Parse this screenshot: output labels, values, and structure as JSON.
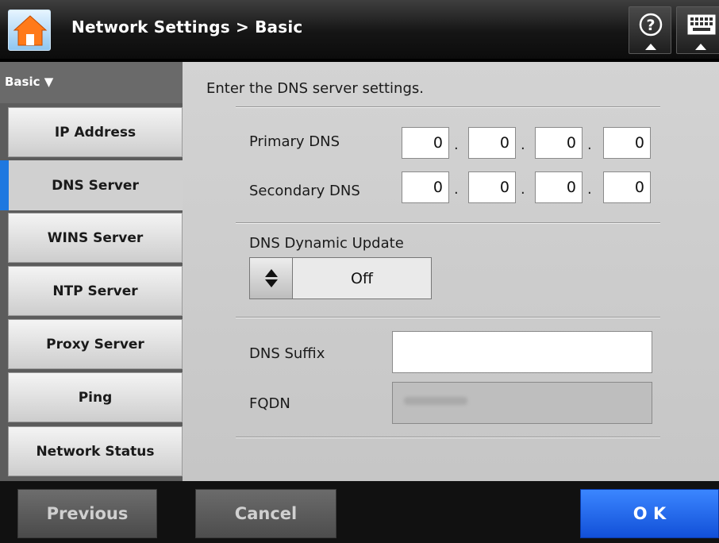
{
  "header": {
    "title": "Network Settings > Basic",
    "home_icon": "home-icon",
    "help_icon": "help-icon",
    "keyboard_icon": "keyboard-icon"
  },
  "sidebar": {
    "group_label": "Basic ▼",
    "items": [
      {
        "label": "IP Address",
        "active": false
      },
      {
        "label": "DNS Server",
        "active": true
      },
      {
        "label": "WINS Server",
        "active": false
      },
      {
        "label": "NTP Server",
        "active": false
      },
      {
        "label": "Proxy Server",
        "active": false
      },
      {
        "label": "Ping",
        "active": false
      },
      {
        "label": "Network Status",
        "active": false
      }
    ],
    "active_color": "#1e78e0"
  },
  "main": {
    "prompt": "Enter the DNS server settings.",
    "primary_dns": {
      "label": "Primary DNS",
      "octets": [
        "0",
        "0",
        "0",
        "0"
      ]
    },
    "secondary_dns": {
      "label": "Secondary DNS",
      "octets": [
        "0",
        "0",
        "0",
        "0"
      ]
    },
    "octet_separator": ".",
    "dynamic_update": {
      "label": "DNS Dynamic Update",
      "value": "Off",
      "spinner_icon": "up-down-arrows-icon"
    },
    "dns_suffix": {
      "label": "DNS Suffix",
      "value": ""
    },
    "fqdn": {
      "label": "FQDN",
      "value": ""
    }
  },
  "footer": {
    "previous_label": "Previous",
    "cancel_label": "Cancel",
    "ok_label": "O K",
    "ok_color": "#1e5ff0"
  }
}
